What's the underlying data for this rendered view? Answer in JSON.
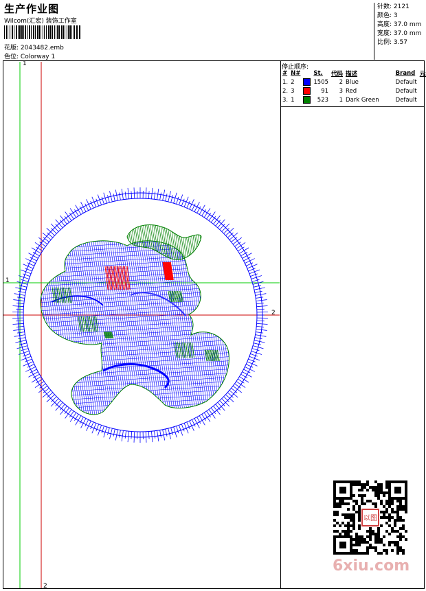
{
  "header": {
    "title": "生产作业图",
    "company": "Wilcom(汇宏) 装饰工作室",
    "design_label": "花版:",
    "design_file": "2043482.emb",
    "colorway_label": "色位:",
    "colorway": "Colorway 1"
  },
  "stats": {
    "stitches_label": "针数:",
    "stitches": "2121",
    "colors_label": "颜色:",
    "colors": "3",
    "height_label": "高度:",
    "height": "37.0 mm",
    "width_label": "宽度:",
    "width": "37.0 mm",
    "scale_label": "比例:",
    "scale": "3.57"
  },
  "stop_sequence": {
    "title": "停止顺序:",
    "columns": [
      "#",
      "N#",
      "St.",
      "代码",
      "描述",
      "Brand",
      "元素"
    ],
    "rows": [
      {
        "idx": "1.",
        "n": "2",
        "color": "#0000ff",
        "st": "1505",
        "code": "2",
        "desc": "Blue",
        "brand": "Default"
      },
      {
        "idx": "2.",
        "n": "3",
        "color": "#ff0000",
        "st": "91",
        "code": "3",
        "desc": "Red",
        "brand": "Default"
      },
      {
        "idx": "3.",
        "n": "1",
        "color": "#008000",
        "st": "523",
        "code": "1",
        "desc": "Dark Green",
        "brand": "Default"
      }
    ]
  },
  "axes": {
    "v1_label": "1",
    "h1_label": "1",
    "v2_label": "2",
    "h2_label": "2"
  },
  "watermark": "6xiu.com",
  "qr_stamp": "以图"
}
